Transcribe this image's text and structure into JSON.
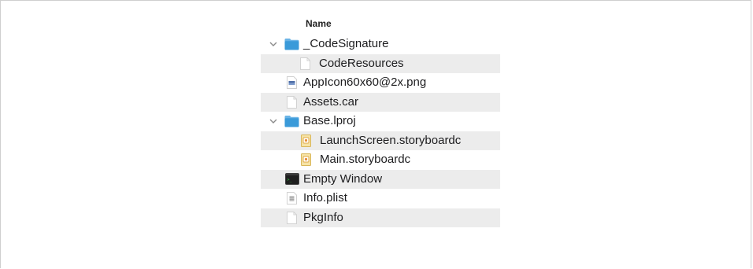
{
  "header": {
    "name_column": "Name"
  },
  "rows": [
    {
      "label": "_CodeSignature",
      "icon": "folder-icon",
      "expanded": true,
      "level": 0
    },
    {
      "label": "CodeResources",
      "icon": "file-icon",
      "level": 1
    },
    {
      "label": "AppIcon60x60@2x.png",
      "icon": "png-image-icon",
      "level": 0
    },
    {
      "label": "Assets.car",
      "icon": "file-icon",
      "level": 0
    },
    {
      "label": "Base.lproj",
      "icon": "folder-icon",
      "expanded": true,
      "level": 0
    },
    {
      "label": "LaunchScreen.storyboardc",
      "icon": "storyboard-icon",
      "level": 1
    },
    {
      "label": "Main.storyboardc",
      "icon": "storyboard-icon",
      "level": 1
    },
    {
      "label": "Empty Window",
      "icon": "executable-icon",
      "level": 0
    },
    {
      "label": "Info.plist",
      "icon": "plist-icon",
      "level": 0
    },
    {
      "label": "PkgInfo",
      "icon": "file-icon",
      "level": 0
    }
  ]
}
